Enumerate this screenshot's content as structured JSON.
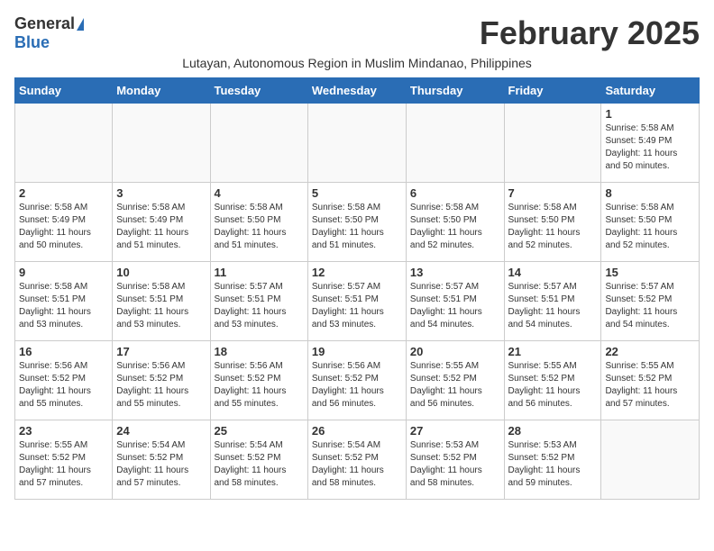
{
  "logo": {
    "general": "General",
    "blue": "Blue"
  },
  "title": "February 2025",
  "subtitle": "Lutayan, Autonomous Region in Muslim Mindanao, Philippines",
  "days_of_week": [
    "Sunday",
    "Monday",
    "Tuesday",
    "Wednesday",
    "Thursday",
    "Friday",
    "Saturday"
  ],
  "weeks": [
    [
      {
        "num": "",
        "info": ""
      },
      {
        "num": "",
        "info": ""
      },
      {
        "num": "",
        "info": ""
      },
      {
        "num": "",
        "info": ""
      },
      {
        "num": "",
        "info": ""
      },
      {
        "num": "",
        "info": ""
      },
      {
        "num": "1",
        "info": "Sunrise: 5:58 AM\nSunset: 5:49 PM\nDaylight: 11 hours\nand 50 minutes."
      }
    ],
    [
      {
        "num": "2",
        "info": "Sunrise: 5:58 AM\nSunset: 5:49 PM\nDaylight: 11 hours\nand 50 minutes."
      },
      {
        "num": "3",
        "info": "Sunrise: 5:58 AM\nSunset: 5:49 PM\nDaylight: 11 hours\nand 51 minutes."
      },
      {
        "num": "4",
        "info": "Sunrise: 5:58 AM\nSunset: 5:50 PM\nDaylight: 11 hours\nand 51 minutes."
      },
      {
        "num": "5",
        "info": "Sunrise: 5:58 AM\nSunset: 5:50 PM\nDaylight: 11 hours\nand 51 minutes."
      },
      {
        "num": "6",
        "info": "Sunrise: 5:58 AM\nSunset: 5:50 PM\nDaylight: 11 hours\nand 52 minutes."
      },
      {
        "num": "7",
        "info": "Sunrise: 5:58 AM\nSunset: 5:50 PM\nDaylight: 11 hours\nand 52 minutes."
      },
      {
        "num": "8",
        "info": "Sunrise: 5:58 AM\nSunset: 5:50 PM\nDaylight: 11 hours\nand 52 minutes."
      }
    ],
    [
      {
        "num": "9",
        "info": "Sunrise: 5:58 AM\nSunset: 5:51 PM\nDaylight: 11 hours\nand 53 minutes."
      },
      {
        "num": "10",
        "info": "Sunrise: 5:58 AM\nSunset: 5:51 PM\nDaylight: 11 hours\nand 53 minutes."
      },
      {
        "num": "11",
        "info": "Sunrise: 5:57 AM\nSunset: 5:51 PM\nDaylight: 11 hours\nand 53 minutes."
      },
      {
        "num": "12",
        "info": "Sunrise: 5:57 AM\nSunset: 5:51 PM\nDaylight: 11 hours\nand 53 minutes."
      },
      {
        "num": "13",
        "info": "Sunrise: 5:57 AM\nSunset: 5:51 PM\nDaylight: 11 hours\nand 54 minutes."
      },
      {
        "num": "14",
        "info": "Sunrise: 5:57 AM\nSunset: 5:51 PM\nDaylight: 11 hours\nand 54 minutes."
      },
      {
        "num": "15",
        "info": "Sunrise: 5:57 AM\nSunset: 5:52 PM\nDaylight: 11 hours\nand 54 minutes."
      }
    ],
    [
      {
        "num": "16",
        "info": "Sunrise: 5:56 AM\nSunset: 5:52 PM\nDaylight: 11 hours\nand 55 minutes."
      },
      {
        "num": "17",
        "info": "Sunrise: 5:56 AM\nSunset: 5:52 PM\nDaylight: 11 hours\nand 55 minutes."
      },
      {
        "num": "18",
        "info": "Sunrise: 5:56 AM\nSunset: 5:52 PM\nDaylight: 11 hours\nand 55 minutes."
      },
      {
        "num": "19",
        "info": "Sunrise: 5:56 AM\nSunset: 5:52 PM\nDaylight: 11 hours\nand 56 minutes."
      },
      {
        "num": "20",
        "info": "Sunrise: 5:55 AM\nSunset: 5:52 PM\nDaylight: 11 hours\nand 56 minutes."
      },
      {
        "num": "21",
        "info": "Sunrise: 5:55 AM\nSunset: 5:52 PM\nDaylight: 11 hours\nand 56 minutes."
      },
      {
        "num": "22",
        "info": "Sunrise: 5:55 AM\nSunset: 5:52 PM\nDaylight: 11 hours\nand 57 minutes."
      }
    ],
    [
      {
        "num": "23",
        "info": "Sunrise: 5:55 AM\nSunset: 5:52 PM\nDaylight: 11 hours\nand 57 minutes."
      },
      {
        "num": "24",
        "info": "Sunrise: 5:54 AM\nSunset: 5:52 PM\nDaylight: 11 hours\nand 57 minutes."
      },
      {
        "num": "25",
        "info": "Sunrise: 5:54 AM\nSunset: 5:52 PM\nDaylight: 11 hours\nand 58 minutes."
      },
      {
        "num": "26",
        "info": "Sunrise: 5:54 AM\nSunset: 5:52 PM\nDaylight: 11 hours\nand 58 minutes."
      },
      {
        "num": "27",
        "info": "Sunrise: 5:53 AM\nSunset: 5:52 PM\nDaylight: 11 hours\nand 58 minutes."
      },
      {
        "num": "28",
        "info": "Sunrise: 5:53 AM\nSunset: 5:52 PM\nDaylight: 11 hours\nand 59 minutes."
      },
      {
        "num": "",
        "info": ""
      }
    ]
  ]
}
